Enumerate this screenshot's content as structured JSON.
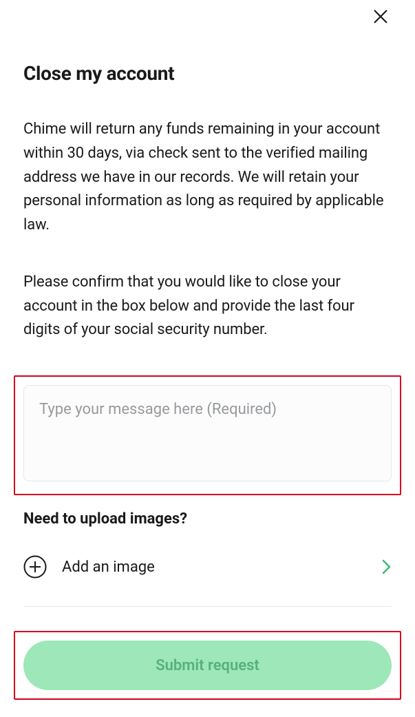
{
  "header": {
    "title": "Close my account"
  },
  "body": {
    "paragraph1": "Chime will return any funds remaining in your account within 30 days, via check sent to the verified mailing address we have in our records. We will retain your personal information as long as required by applicable law.",
    "paragraph2": "Please confirm that you would like to close your account in the box below and provide the last four digits of your social security number."
  },
  "message": {
    "placeholder": "Type your message here (Required)",
    "value": ""
  },
  "upload": {
    "heading": "Need to upload images?",
    "add_label": "Add an image"
  },
  "actions": {
    "submit_label": "Submit request"
  },
  "colors": {
    "highlight": "#d6001c",
    "submit_bg": "#9de7b8",
    "submit_text": "#58b07a"
  }
}
